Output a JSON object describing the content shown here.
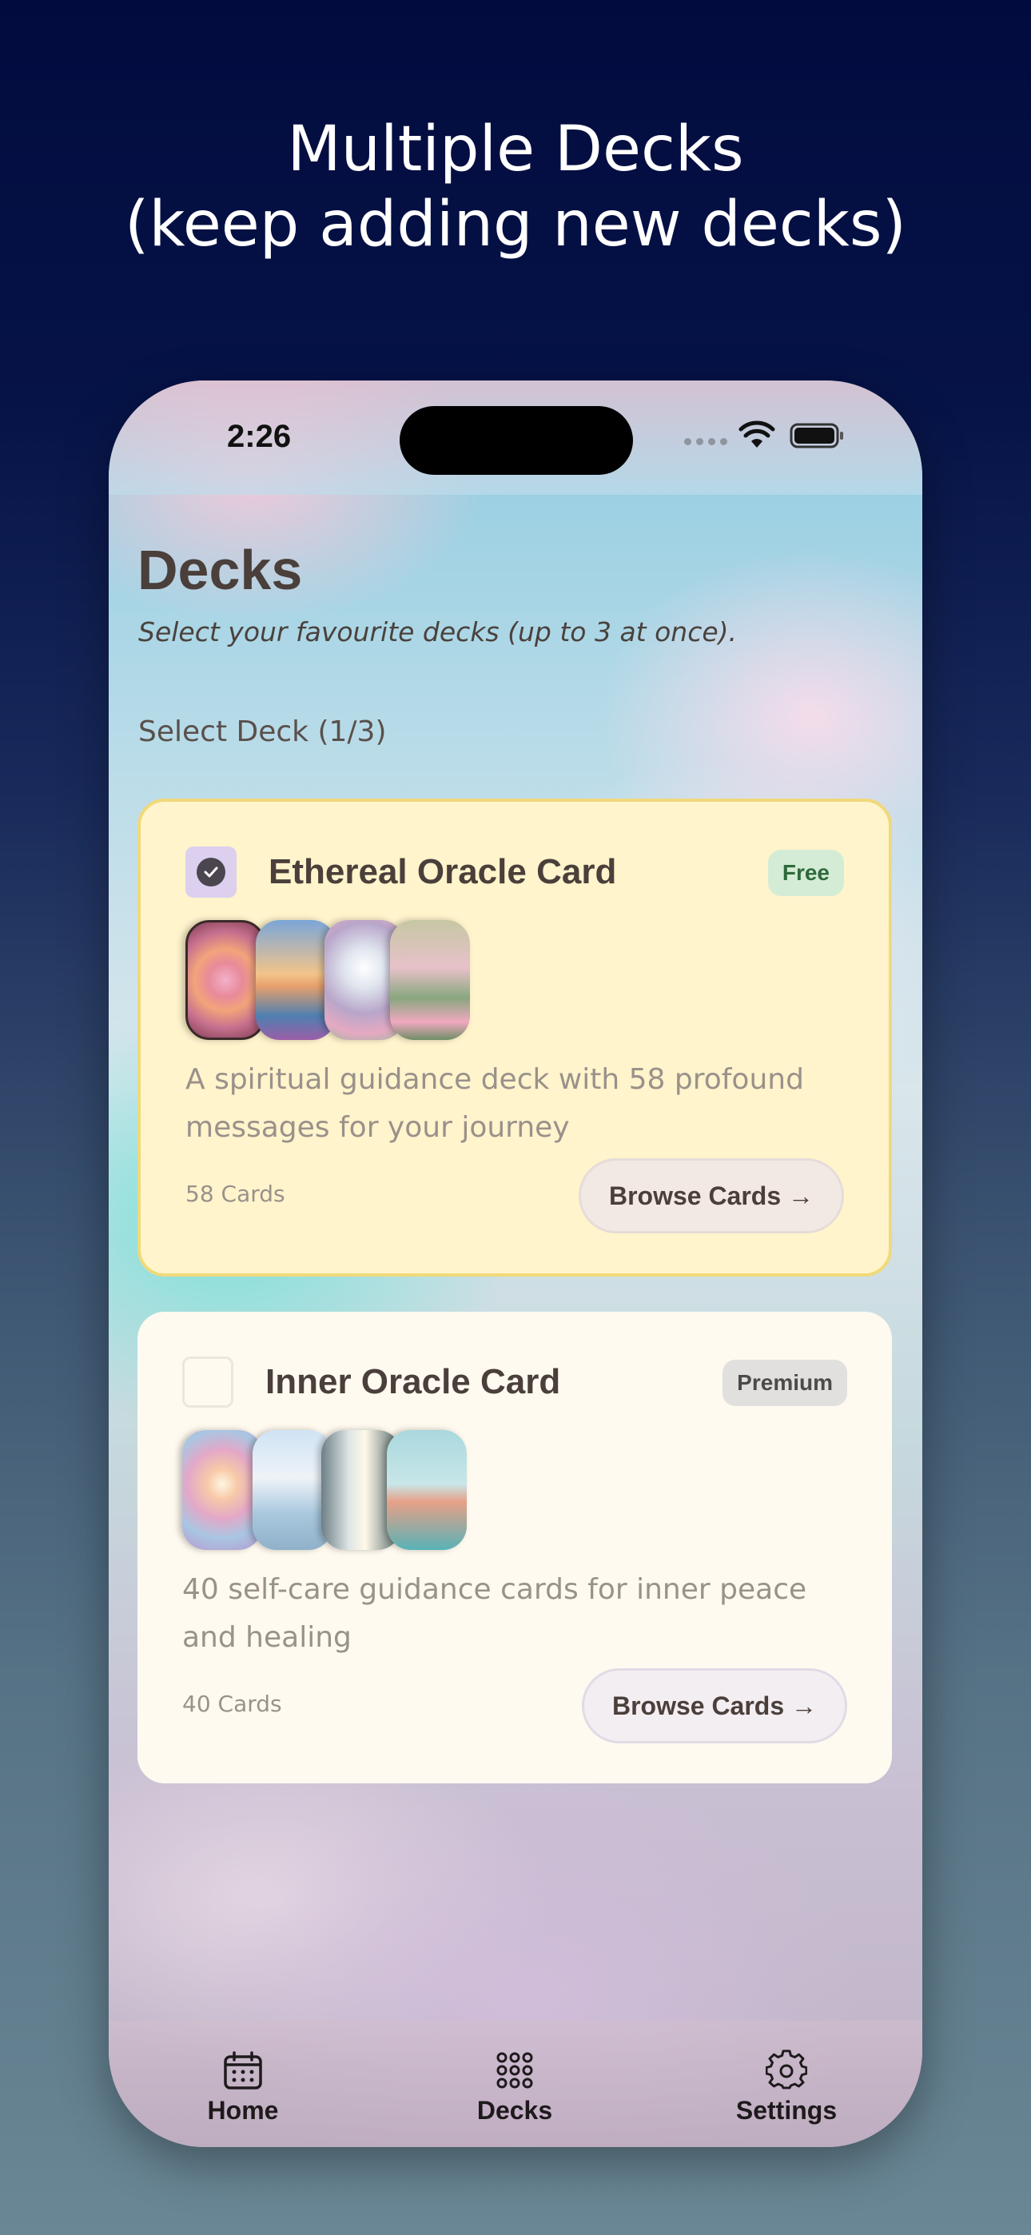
{
  "headline": {
    "line1": "Multiple Decks",
    "line2": "(keep adding new decks)"
  },
  "status_bar": {
    "time": "2:26",
    "icons": [
      "cellular-icon",
      "wifi-icon",
      "battery-icon"
    ]
  },
  "page": {
    "title": "Decks",
    "subtitle": "Select your favourite decks (up to 3 at once).",
    "section_label": "Select Deck (1/3)"
  },
  "decks": [
    {
      "name": "Ethereal Oracle Card",
      "badge": "Free",
      "selected": true,
      "description": "A spiritual guidance deck with 58 profound messages for your journey",
      "count": "58 Cards",
      "browse_label": "Browse Cards →"
    },
    {
      "name": "Inner Oracle Card",
      "badge": "Premium",
      "selected": false,
      "description": "40 self-care guidance cards for inner peace and healing",
      "count": "40 Cards",
      "browse_label": "Browse Cards →"
    }
  ],
  "tab_bar": {
    "items": [
      {
        "label": "Home",
        "icon": "calendar-icon"
      },
      {
        "label": "Decks",
        "icon": "grid-dots-icon"
      },
      {
        "label": "Settings",
        "icon": "gear-icon"
      }
    ]
  },
  "colors": {
    "background_top": "#020b3e",
    "selected_card": "#fff4cc",
    "free_badge": "#d4ecd6",
    "premium_badge": "#e2e0de"
  }
}
